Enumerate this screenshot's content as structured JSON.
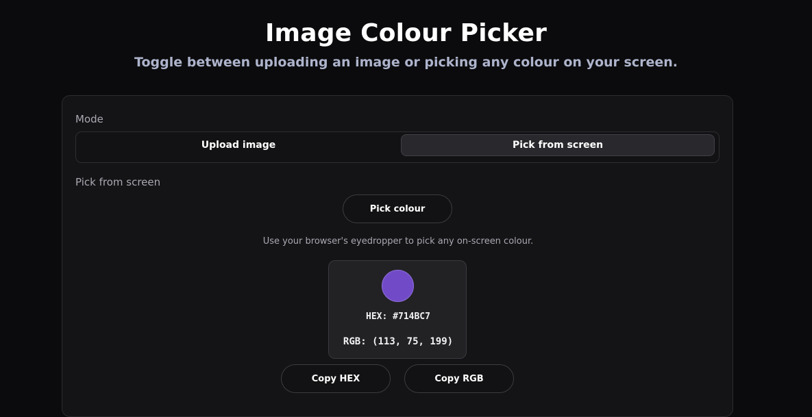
{
  "header": {
    "title": "Image Colour Picker",
    "subtitle": "Toggle between uploading an image or picking any colour on your screen."
  },
  "mode": {
    "label": "Mode",
    "options": [
      {
        "label": "Upload image",
        "selected": false
      },
      {
        "label": "Pick from screen",
        "selected": true
      }
    ]
  },
  "picker": {
    "section_label": "Pick from screen",
    "pick_button": "Pick colour",
    "hint": "Use your browser's eyedropper to pick any on-screen colour.",
    "swatch_color": "#714BC7",
    "hex_text": "HEX: #714BC7",
    "rgb_text": "RGB: (113, 75, 199)",
    "copy_hex": "Copy HEX",
    "copy_rgb": "Copy RGB"
  }
}
